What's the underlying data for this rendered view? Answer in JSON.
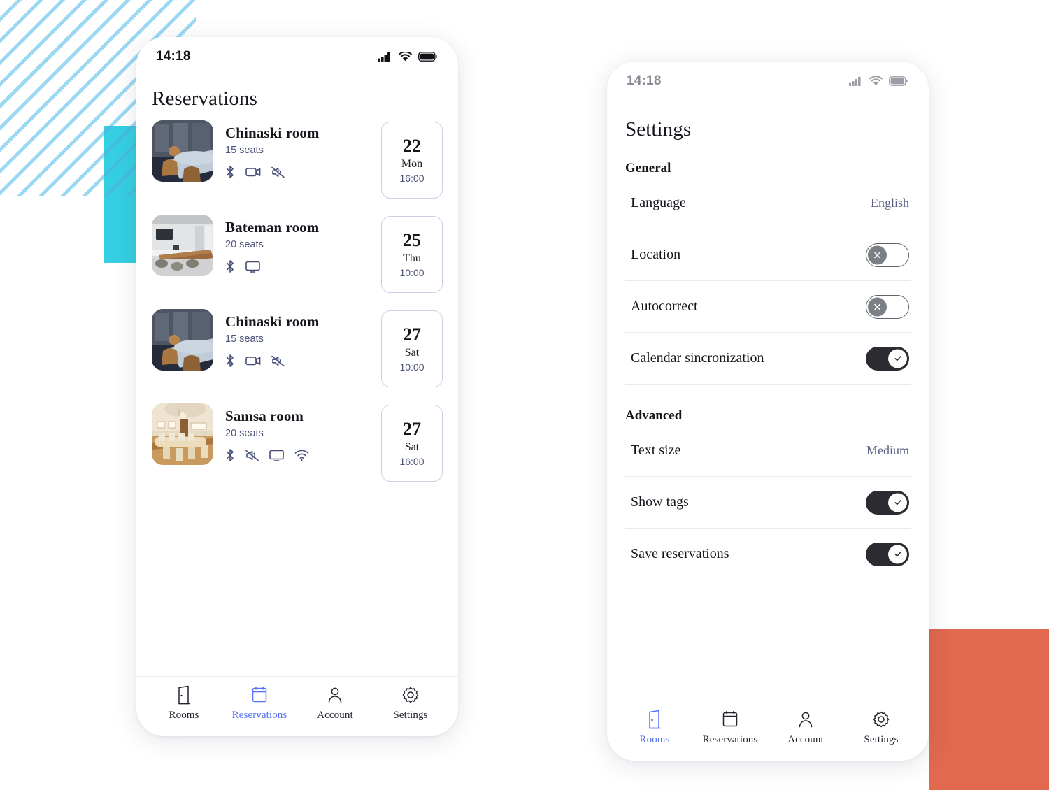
{
  "decor": {
    "stripe_color": "#9bd9f3",
    "cyan_block_color": "#35cfe3",
    "orange_block_color": "#e0694f"
  },
  "theme": {
    "accent_blue": "#5570f1",
    "text_dark": "#15161c",
    "text_muted": "#4d5378",
    "card_border": "#ccd0e6"
  },
  "phone_left": {
    "status": {
      "time": "14:18",
      "signal": "signal-bars-icon",
      "wifi": "wifi-icon",
      "battery": "battery-full-icon"
    },
    "title": "Reservations",
    "reservations": [
      {
        "name": "Chinaski room",
        "seats": "15 seats",
        "amenities": [
          "bluetooth-icon",
          "video-camera-icon",
          "speaker-muted-icon"
        ],
        "day": "22",
        "dow": "Mon",
        "time": "16:00",
        "thumb": "dark-blue-conference-room"
      },
      {
        "name": "Bateman room",
        "seats": "20 seats",
        "amenities": [
          "bluetooth-icon",
          "monitor-icon"
        ],
        "day": "25",
        "dow": "Thu",
        "time": "10:00",
        "thumb": "grey-modern-meeting-room"
      },
      {
        "name": "Chinaski room",
        "seats": "15 seats",
        "amenities": [
          "bluetooth-icon",
          "video-camera-icon",
          "speaker-muted-icon"
        ],
        "day": "27",
        "dow": "Sat",
        "time": "10:00",
        "thumb": "dark-blue-conference-room"
      },
      {
        "name": "Samsa room",
        "seats": "20 seats",
        "amenities": [
          "bluetooth-icon",
          "speaker-muted-icon",
          "monitor-icon",
          "wifi-icon"
        ],
        "day": "27",
        "dow": "Sat",
        "time": "16:00",
        "thumb": "warm-wood-boardroom"
      }
    ],
    "tabs": [
      {
        "label": "Rooms",
        "icon": "door-icon",
        "active": false
      },
      {
        "label": "Reservations",
        "icon": "calendar-icon",
        "active": true
      },
      {
        "label": "Account",
        "icon": "person-icon",
        "active": false
      },
      {
        "label": "Settings",
        "icon": "gear-icon",
        "active": false
      }
    ]
  },
  "phone_right": {
    "status": {
      "time": "14:18",
      "signal": "signal-bars-icon",
      "wifi": "wifi-icon",
      "battery": "battery-full-icon"
    },
    "title": "Settings",
    "sections": [
      {
        "heading": "General",
        "rows": [
          {
            "label": "Language",
            "type": "value",
            "value": "English"
          },
          {
            "label": "Location",
            "type": "toggle",
            "on": false
          },
          {
            "label": "Autocorrect",
            "type": "toggle",
            "on": false
          },
          {
            "label": "Calendar sincronization",
            "type": "toggle",
            "on": true
          }
        ]
      },
      {
        "heading": "Advanced",
        "rows": [
          {
            "label": "Text size",
            "type": "value",
            "value": "Medium"
          },
          {
            "label": "Show tags",
            "type": "toggle",
            "on": true
          },
          {
            "label": "Save reservations",
            "type": "toggle",
            "on": true
          }
        ]
      }
    ],
    "tabs": [
      {
        "label": "Rooms",
        "icon": "door-icon",
        "active": true
      },
      {
        "label": "Reservations",
        "icon": "calendar-icon",
        "active": false
      },
      {
        "label": "Account",
        "icon": "person-icon",
        "active": false
      },
      {
        "label": "Settings",
        "icon": "gear-icon",
        "active": false
      }
    ]
  }
}
